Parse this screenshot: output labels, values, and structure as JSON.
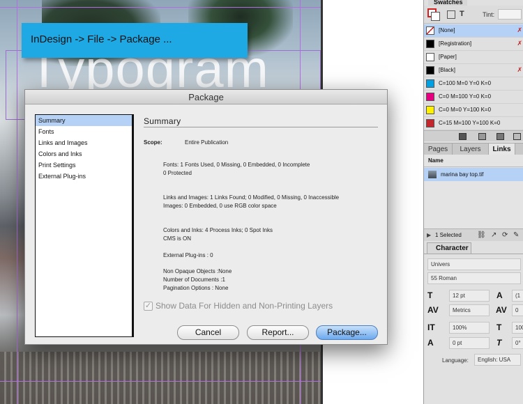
{
  "document": {
    "headline_fragment": "Typogram"
  },
  "callout": {
    "text": "InDesign -> File ->  Package ..."
  },
  "dialog": {
    "title": "Package",
    "categories": [
      {
        "label": "Summary",
        "selected": true
      },
      {
        "label": "Fonts",
        "selected": false
      },
      {
        "label": "Links and Images",
        "selected": false
      },
      {
        "label": "Colors and Inks",
        "selected": false
      },
      {
        "label": "Print Settings",
        "selected": false
      },
      {
        "label": "External Plug-ins",
        "selected": false
      }
    ],
    "summary_heading": "Summary",
    "scope_label": "Scope:",
    "scope_value": "Entire Publication",
    "fonts_line1": "Fonts: 1 Fonts Used, 0 Missing, 0 Embedded, 0 Incomplete",
    "fonts_line2": "0 Protected",
    "links_line1": "Links and Images: 1 Links Found; 0 Modified, 0 Missing, 0 Inaccessible",
    "links_line2": "Images: 0 Embedded, 0 use RGB color space",
    "colors_line1": "Colors and Inks: 4 Process Inks; 0 Spot Inks",
    "colors_line2": "CMS is ON",
    "plugins_line": "External Plug-ins : 0",
    "nonopaque_line": "Non Opaque Objects :None",
    "docs_line": "Number of Documents :1",
    "pagination_line": "Pagination Options : None",
    "show_hidden_label": "Show Data For Hidden and Non-Printing Layers",
    "show_hidden_checked": true,
    "buttons": {
      "cancel": "Cancel",
      "report": "Report...",
      "package": "Package..."
    }
  },
  "swatches": {
    "tab_label": "Swatches",
    "tint_label": "Tint:",
    "rows": [
      {
        "name": "[None]",
        "color": "#ffffff",
        "selected": true,
        "locked": true
      },
      {
        "name": "[Registration]",
        "color": "#000000",
        "selected": false,
        "locked": true
      },
      {
        "name": "[Paper]",
        "color": "#ffffff",
        "selected": false,
        "locked": false
      },
      {
        "name": "[Black]",
        "color": "#000000",
        "selected": false,
        "locked": true
      },
      {
        "name": "C=100 M=0 Y=0 K=0",
        "color": "#00a0e3",
        "selected": false,
        "locked": false
      },
      {
        "name": "C=0 M=100 Y=0 K=0",
        "color": "#e4007f",
        "selected": false,
        "locked": false
      },
      {
        "name": "C=0 M=0 Y=100 K=0",
        "color": "#fff100",
        "selected": false,
        "locked": false
      },
      {
        "name": "C=15 M=100 Y=100 K=0",
        "color": "#c1272d",
        "selected": false,
        "locked": false
      }
    ]
  },
  "panel_tabs": [
    "Pages",
    "Layers",
    "Links"
  ],
  "links": {
    "column_header": "Name",
    "items": [
      "marina bay top.tif"
    ],
    "status": "1 Selected"
  },
  "character": {
    "tab_label": "Character",
    "font_family": "Univers",
    "font_style": "55 Roman",
    "size": "12 pt",
    "leading": "(1",
    "kerning": "Metrics",
    "tracking": "0",
    "vertical_scale": "100%",
    "horizontal_scale": "100%",
    "baseline_shift": "0 pt",
    "skew": "0°",
    "language_label": "Language:",
    "language_value": "English: USA"
  }
}
